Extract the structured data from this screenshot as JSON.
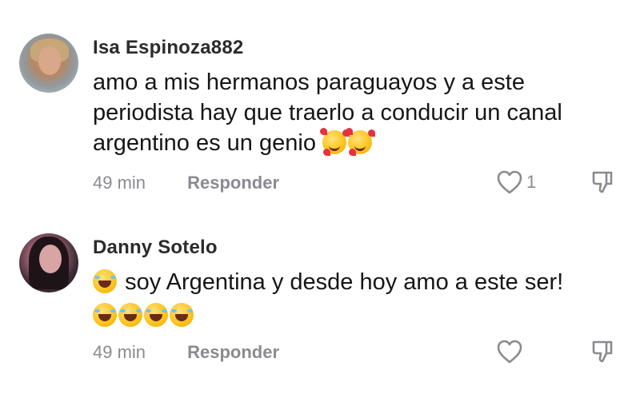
{
  "comments": [
    {
      "username": "Isa Espinoza882",
      "text_lines": [
        "amo a mis hermanos paraguayos y a este",
        "periodista hay que traerlo a conducir un canal",
        "argentino es un genio"
      ],
      "emojis": [
        "smiling-face-with-hearts",
        "smiling-face-with-hearts"
      ],
      "time": "49 min",
      "reply_label": "Responder",
      "like_count": "1"
    },
    {
      "username": "Danny Sotelo",
      "text": "soy Argentina y desde hoy amo a este ser!",
      "emojis_leading": [
        "rolling-on-floor-laughing"
      ],
      "emojis_trailing": [
        "rolling-on-floor-laughing",
        "rolling-on-floor-laughing",
        "rolling-on-floor-laughing",
        "rolling-on-floor-laughing"
      ],
      "time": "49 min",
      "reply_label": "Responder",
      "like_count": ""
    }
  ],
  "icons": {
    "like": "heart-outline-icon",
    "dislike": "thumbs-down-icon"
  }
}
